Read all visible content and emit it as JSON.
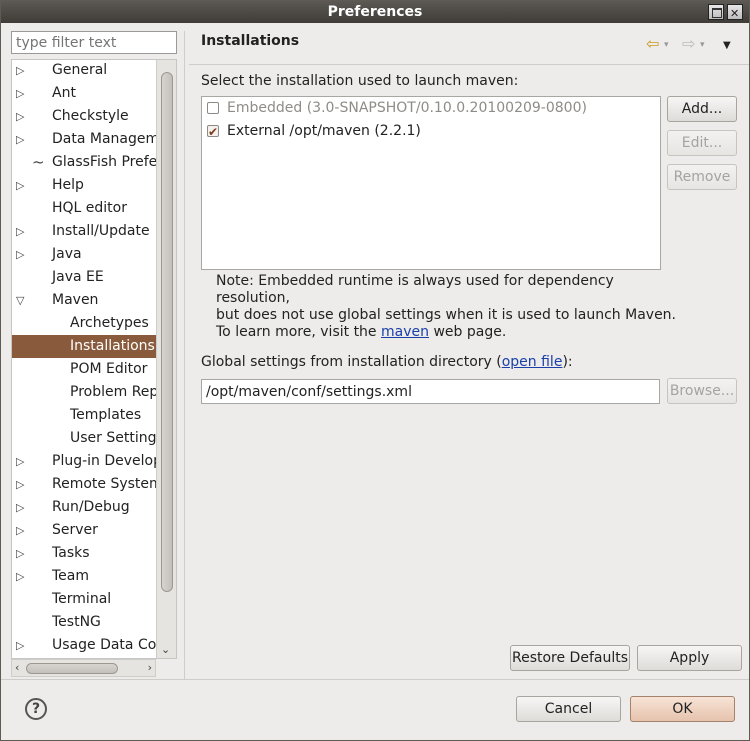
{
  "window": {
    "title": "Preferences"
  },
  "filter": {
    "placeholder": "type filter text"
  },
  "tree": {
    "items": [
      {
        "label": "General",
        "arrow": "▷",
        "indent": 0
      },
      {
        "label": "Ant",
        "arrow": "▷",
        "indent": 0
      },
      {
        "label": "Checkstyle",
        "arrow": "▷",
        "indent": 0
      },
      {
        "label": "Data Management",
        "arrow": "▷",
        "indent": 0
      },
      {
        "label": "GlassFish Preferences",
        "arrow": "",
        "indent": 0,
        "icon": "glassfish-icon"
      },
      {
        "label": "Help",
        "arrow": "▷",
        "indent": 0
      },
      {
        "label": "HQL editor",
        "arrow": "",
        "indent": 0
      },
      {
        "label": "Install/Update",
        "arrow": "▷",
        "indent": 0
      },
      {
        "label": "Java",
        "arrow": "▷",
        "indent": 0
      },
      {
        "label": "Java EE",
        "arrow": "",
        "indent": 0
      },
      {
        "label": "Maven",
        "arrow": "▽",
        "indent": 0
      },
      {
        "label": "Archetypes",
        "arrow": "",
        "indent": 1
      },
      {
        "label": "Installations",
        "arrow": "",
        "indent": 1,
        "selected": true
      },
      {
        "label": "POM Editor",
        "arrow": "",
        "indent": 1
      },
      {
        "label": "Problem Reporting",
        "arrow": "",
        "indent": 1
      },
      {
        "label": "Templates",
        "arrow": "",
        "indent": 1
      },
      {
        "label": "User Settings",
        "arrow": "",
        "indent": 1
      },
      {
        "label": "Plug-in Development",
        "arrow": "▷",
        "indent": 0
      },
      {
        "label": "Remote Systems",
        "arrow": "▷",
        "indent": 0
      },
      {
        "label": "Run/Debug",
        "arrow": "▷",
        "indent": 0
      },
      {
        "label": "Server",
        "arrow": "▷",
        "indent": 0
      },
      {
        "label": "Tasks",
        "arrow": "▷",
        "indent": 0
      },
      {
        "label": "Team",
        "arrow": "▷",
        "indent": 0
      },
      {
        "label": "Terminal",
        "arrow": "",
        "indent": 0
      },
      {
        "label": "TestNG",
        "arrow": "",
        "indent": 0
      },
      {
        "label": "Usage Data Collector",
        "arrow": "▷",
        "indent": 0
      }
    ]
  },
  "page": {
    "title": "Installations",
    "select_label": "Select the installation used to launch maven:",
    "installations": [
      {
        "label": "Embedded (3.0-SNAPSHOT/0.10.0.20100209-0800)",
        "checked": false,
        "enabled": false
      },
      {
        "label": "External /opt/maven (2.2.1)",
        "checked": true,
        "enabled": true
      }
    ],
    "buttons": {
      "add": "Add...",
      "edit": "Edit...",
      "remove": "Remove"
    },
    "note_line1": "Note: Embedded runtime is always used for dependency resolution,",
    "note_line2": "but does not use global settings when it is used to launch Maven.",
    "note_line3_prefix": "To learn more, visit the ",
    "note_link": "maven",
    "note_line3_suffix": " web page.",
    "global_prefix": "Global settings from installation directory (",
    "global_link": "open file",
    "global_suffix": "):",
    "settings_path": "/opt/maven/conf/settings.xml",
    "browse": "Browse...",
    "restore_defaults": "Restore Defaults",
    "apply": "Apply"
  },
  "footer": {
    "help": "?",
    "cancel": "Cancel",
    "ok": "OK"
  },
  "colors": {
    "selection": "#8a5a3c",
    "link": "#1a3fa8",
    "titlebar": "#4a4742"
  }
}
